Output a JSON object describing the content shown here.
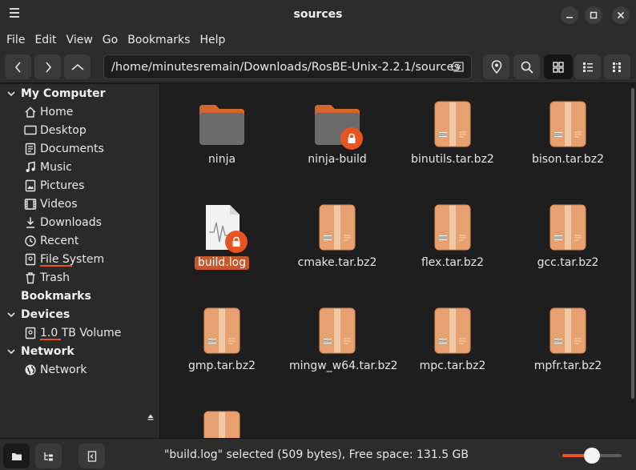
{
  "window": {
    "title": "sources"
  },
  "menu": [
    "File",
    "Edit",
    "View",
    "Go",
    "Bookmarks",
    "Help"
  ],
  "toolbar": {
    "path": "/home/minutesremain/Downloads/RosBE-Unix-2.2.1/sources"
  },
  "sidebar": {
    "sections": [
      {
        "title": "My Computer",
        "items": [
          "Home",
          "Desktop",
          "Documents",
          "Music",
          "Pictures",
          "Videos",
          "Downloads",
          "Recent",
          "File System",
          "Trash"
        ]
      },
      {
        "title": "Bookmarks",
        "items": []
      },
      {
        "title": "Devices",
        "items": [
          "1.0 TB Volume"
        ]
      },
      {
        "title": "Network",
        "items": [
          "Network"
        ]
      }
    ]
  },
  "files": [
    {
      "name": "ninja",
      "type": "folder",
      "locked": false,
      "selected": false
    },
    {
      "name": "ninja-build",
      "type": "folder",
      "locked": true,
      "selected": false
    },
    {
      "name": "binutils.tar.bz2",
      "type": "archive",
      "locked": false,
      "selected": false
    },
    {
      "name": "bison.tar.bz2",
      "type": "archive",
      "locked": false,
      "selected": false
    },
    {
      "name": "build.log",
      "type": "log",
      "locked": true,
      "selected": true
    },
    {
      "name": "cmake.tar.bz2",
      "type": "archive",
      "locked": false,
      "selected": false
    },
    {
      "name": "flex.tar.bz2",
      "type": "archive",
      "locked": false,
      "selected": false
    },
    {
      "name": "gcc.tar.bz2",
      "type": "archive",
      "locked": false,
      "selected": false
    },
    {
      "name": "gmp.tar.bz2",
      "type": "archive",
      "locked": false,
      "selected": false
    },
    {
      "name": "mingw_w64.tar.bz2",
      "type": "archive",
      "locked": false,
      "selected": false
    },
    {
      "name": "mpc.tar.bz2",
      "type": "archive",
      "locked": false,
      "selected": false
    },
    {
      "name": "mpfr.tar.bz2",
      "type": "archive",
      "locked": false,
      "selected": false
    },
    {
      "name": "",
      "type": "archive",
      "locked": false,
      "selected": false
    }
  ],
  "status": {
    "text": "\"build.log\" selected (509 bytes), Free space: 131.5 GB",
    "zoom_fraction": 0.5
  },
  "colors": {
    "accent": "#e95420",
    "selection": "#c7582b",
    "folder": "#6b6b6b",
    "folder_tab": "#d5652f",
    "archive": "#e9a070"
  }
}
